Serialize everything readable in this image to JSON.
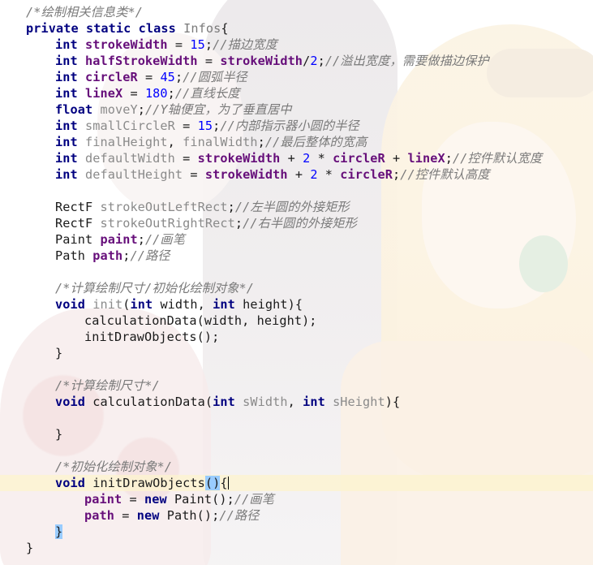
{
  "editor": {
    "lines": [
      {
        "indent": 1,
        "current": false,
        "tokens": [
          {
            "t": "cm",
            "v": "/*绘制相关信息类*/"
          }
        ]
      },
      {
        "indent": 1,
        "current": false,
        "tokens": [
          {
            "t": "kw",
            "v": "private static class "
          },
          {
            "t": "cls",
            "v": "Infos"
          },
          {
            "t": "",
            "v": "{"
          }
        ]
      },
      {
        "indent": 2,
        "current": false,
        "tokens": [
          {
            "t": "kw",
            "v": "int "
          },
          {
            "t": "fld",
            "v": "strokeWidth"
          },
          {
            "t": "",
            "v": " = "
          },
          {
            "t": "num",
            "v": "15"
          },
          {
            "t": "",
            "v": ";"
          },
          {
            "t": "cm",
            "v": "//描边宽度"
          }
        ]
      },
      {
        "indent": 2,
        "current": false,
        "tokens": [
          {
            "t": "kw",
            "v": "int "
          },
          {
            "t": "fld",
            "v": "halfStrokeWidth"
          },
          {
            "t": "",
            "v": " = "
          },
          {
            "t": "fld",
            "v": "strokeWidth"
          },
          {
            "t": "",
            "v": "/"
          },
          {
            "t": "num",
            "v": "2"
          },
          {
            "t": "",
            "v": ";"
          },
          {
            "t": "cm",
            "v": "//溢出宽度，需要做描边保护"
          }
        ]
      },
      {
        "indent": 2,
        "current": false,
        "tokens": [
          {
            "t": "kw",
            "v": "int "
          },
          {
            "t": "fld",
            "v": "circleR"
          },
          {
            "t": "",
            "v": " = "
          },
          {
            "t": "num",
            "v": "45"
          },
          {
            "t": "",
            "v": ";"
          },
          {
            "t": "cm",
            "v": "//圆弧半径"
          }
        ]
      },
      {
        "indent": 2,
        "current": false,
        "tokens": [
          {
            "t": "kw",
            "v": "int "
          },
          {
            "t": "fld",
            "v": "lineX"
          },
          {
            "t": "",
            "v": " = "
          },
          {
            "t": "num",
            "v": "180"
          },
          {
            "t": "",
            "v": ";"
          },
          {
            "t": "cm",
            "v": "//直线长度"
          }
        ]
      },
      {
        "indent": 2,
        "current": false,
        "tokens": [
          {
            "t": "kw",
            "v": "float "
          },
          {
            "t": "dim",
            "v": "moveY"
          },
          {
            "t": "",
            "v": ";"
          },
          {
            "t": "cm",
            "v": "//Y轴便宜，为了垂直居中"
          }
        ]
      },
      {
        "indent": 2,
        "current": false,
        "tokens": [
          {
            "t": "kw",
            "v": "int "
          },
          {
            "t": "dim",
            "v": "smallCircleR"
          },
          {
            "t": "",
            "v": " = "
          },
          {
            "t": "num",
            "v": "15"
          },
          {
            "t": "",
            "v": ";"
          },
          {
            "t": "cm",
            "v": "//内部指示器小圆的半径"
          }
        ]
      },
      {
        "indent": 2,
        "current": false,
        "tokens": [
          {
            "t": "kw",
            "v": "int "
          },
          {
            "t": "dim",
            "v": "finalHeight"
          },
          {
            "t": "",
            "v": ", "
          },
          {
            "t": "dim",
            "v": "finalWidth"
          },
          {
            "t": "",
            "v": ";"
          },
          {
            "t": "cm",
            "v": "//最后整体的宽高"
          }
        ]
      },
      {
        "indent": 2,
        "current": false,
        "tokens": [
          {
            "t": "kw",
            "v": "int "
          },
          {
            "t": "dim",
            "v": "defaultWidth"
          },
          {
            "t": "",
            "v": " = "
          },
          {
            "t": "fld",
            "v": "strokeWidth"
          },
          {
            "t": "",
            "v": " + "
          },
          {
            "t": "num",
            "v": "2"
          },
          {
            "t": "",
            "v": " * "
          },
          {
            "t": "fld",
            "v": "circleR"
          },
          {
            "t": "",
            "v": " + "
          },
          {
            "t": "fld",
            "v": "lineX"
          },
          {
            "t": "",
            "v": ";"
          },
          {
            "t": "cm",
            "v": "//控件默认宽度"
          }
        ]
      },
      {
        "indent": 2,
        "current": false,
        "tokens": [
          {
            "t": "kw",
            "v": "int "
          },
          {
            "t": "dim",
            "v": "defaultHeight"
          },
          {
            "t": "",
            "v": " = "
          },
          {
            "t": "fld",
            "v": "strokeWidth"
          },
          {
            "t": "",
            "v": " + "
          },
          {
            "t": "num",
            "v": "2"
          },
          {
            "t": "",
            "v": " * "
          },
          {
            "t": "fld",
            "v": "circleR"
          },
          {
            "t": "",
            "v": ";"
          },
          {
            "t": "cm",
            "v": "//控件默认高度"
          }
        ]
      },
      {
        "indent": 0,
        "current": false,
        "tokens": []
      },
      {
        "indent": 2,
        "current": false,
        "tokens": [
          {
            "t": "",
            "v": "RectF "
          },
          {
            "t": "dim",
            "v": "strokeOutLeftRect"
          },
          {
            "t": "",
            "v": ";"
          },
          {
            "t": "cm",
            "v": "//左半圆的外接矩形"
          }
        ]
      },
      {
        "indent": 2,
        "current": false,
        "tokens": [
          {
            "t": "",
            "v": "RectF "
          },
          {
            "t": "dim",
            "v": "strokeOutRightRect"
          },
          {
            "t": "",
            "v": ";"
          },
          {
            "t": "cm",
            "v": "//右半圆的外接矩形"
          }
        ]
      },
      {
        "indent": 2,
        "current": false,
        "tokens": [
          {
            "t": "",
            "v": "Paint "
          },
          {
            "t": "fld",
            "v": "paint"
          },
          {
            "t": "",
            "v": ";"
          },
          {
            "t": "cm",
            "v": "//画笔"
          }
        ]
      },
      {
        "indent": 2,
        "current": false,
        "tokens": [
          {
            "t": "",
            "v": "Path "
          },
          {
            "t": "fld",
            "v": "path"
          },
          {
            "t": "",
            "v": ";"
          },
          {
            "t": "cm",
            "v": "//路径"
          }
        ]
      },
      {
        "indent": 0,
        "current": false,
        "tokens": []
      },
      {
        "indent": 2,
        "current": false,
        "tokens": [
          {
            "t": "cm",
            "v": "/*计算绘制尺寸/初始化绘制对象*/"
          }
        ]
      },
      {
        "indent": 2,
        "current": false,
        "tokens": [
          {
            "t": "kw",
            "v": "void "
          },
          {
            "t": "dim",
            "v": "init"
          },
          {
            "t": "",
            "v": "("
          },
          {
            "t": "kw",
            "v": "int "
          },
          {
            "t": "",
            "v": "width, "
          },
          {
            "t": "kw",
            "v": "int "
          },
          {
            "t": "",
            "v": "height){"
          }
        ]
      },
      {
        "indent": 3,
        "current": false,
        "tokens": [
          {
            "t": "",
            "v": "calculationData(width, height);"
          }
        ]
      },
      {
        "indent": 3,
        "current": false,
        "tokens": [
          {
            "t": "",
            "v": "initDrawObjects();"
          }
        ]
      },
      {
        "indent": 2,
        "current": false,
        "tokens": [
          {
            "t": "",
            "v": "}"
          }
        ]
      },
      {
        "indent": 0,
        "current": false,
        "tokens": []
      },
      {
        "indent": 2,
        "current": false,
        "tokens": [
          {
            "t": "cm",
            "v": "/*计算绘制尺寸*/"
          }
        ]
      },
      {
        "indent": 2,
        "current": false,
        "tokens": [
          {
            "t": "kw",
            "v": "void "
          },
          {
            "t": "",
            "v": "calculationData("
          },
          {
            "t": "kw",
            "v": "int "
          },
          {
            "t": "dim",
            "v": "sWidth"
          },
          {
            "t": "",
            "v": ", "
          },
          {
            "t": "kw",
            "v": "int "
          },
          {
            "t": "dim",
            "v": "sHeight"
          },
          {
            "t": "",
            "v": "){"
          }
        ]
      },
      {
        "indent": 0,
        "current": false,
        "tokens": []
      },
      {
        "indent": 2,
        "current": false,
        "tokens": [
          {
            "t": "",
            "v": "}"
          }
        ]
      },
      {
        "indent": 0,
        "current": false,
        "tokens": []
      },
      {
        "indent": 2,
        "current": false,
        "tokens": [
          {
            "t": "cm",
            "v": "/*初始化绘制对象*/"
          }
        ]
      },
      {
        "indent": 2,
        "current": true,
        "tokens": [
          {
            "t": "kw",
            "v": "void "
          },
          {
            "t": "",
            "v": "initDrawObjects"
          },
          {
            "t": "mat",
            "v": "()"
          },
          {
            "t": "",
            "v": "{"
          },
          {
            "t": "caret",
            "v": ""
          }
        ]
      },
      {
        "indent": 3,
        "current": false,
        "tokens": [
          {
            "t": "fld",
            "v": "paint"
          },
          {
            "t": "",
            "v": " = "
          },
          {
            "t": "kw",
            "v": "new "
          },
          {
            "t": "",
            "v": "Paint();"
          },
          {
            "t": "cm",
            "v": "//画笔"
          }
        ]
      },
      {
        "indent": 3,
        "current": false,
        "tokens": [
          {
            "t": "fld",
            "v": "path"
          },
          {
            "t": "",
            "v": " = "
          },
          {
            "t": "kw",
            "v": "new "
          },
          {
            "t": "",
            "v": "Path();"
          },
          {
            "t": "cm",
            "v": "//路径"
          }
        ]
      },
      {
        "indent": 2,
        "current": false,
        "tokens": [
          {
            "t": "mat",
            "v": "}"
          }
        ]
      },
      {
        "indent": 1,
        "current": false,
        "tokens": [
          {
            "t": "",
            "v": "}"
          }
        ]
      }
    ]
  }
}
